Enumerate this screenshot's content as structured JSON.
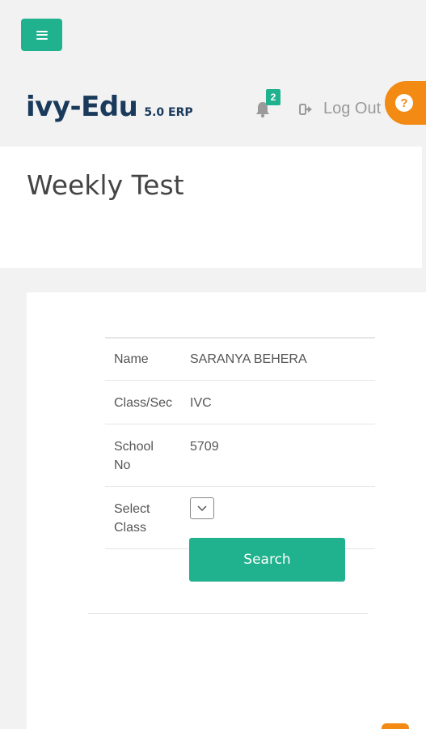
{
  "header": {
    "brand": "ivy-Edu",
    "version": "5.0 ERP",
    "notification_count": "2",
    "logout_label": "Log Out",
    "help_symbol": "?"
  },
  "page": {
    "title": "Weekly Test"
  },
  "student": {
    "rows": [
      {
        "label": "Name",
        "value": "SARANYA BEHERA"
      },
      {
        "label": "Class/Sec",
        "value": "IVC"
      },
      {
        "label": "School No",
        "value": "5709"
      },
      {
        "label": "Select Class",
        "value": ""
      }
    ]
  },
  "actions": {
    "search_label": "Search"
  },
  "colors": {
    "primary": "#20b28e",
    "accent": "#f28a14",
    "brand_text": "#1a3a5c"
  },
  "icons": {
    "menu": "hamburger-icon",
    "notifications": "bell-icon",
    "logout": "sign-out-icon",
    "help": "question-circle-icon",
    "select": "chevron-down-icon"
  }
}
